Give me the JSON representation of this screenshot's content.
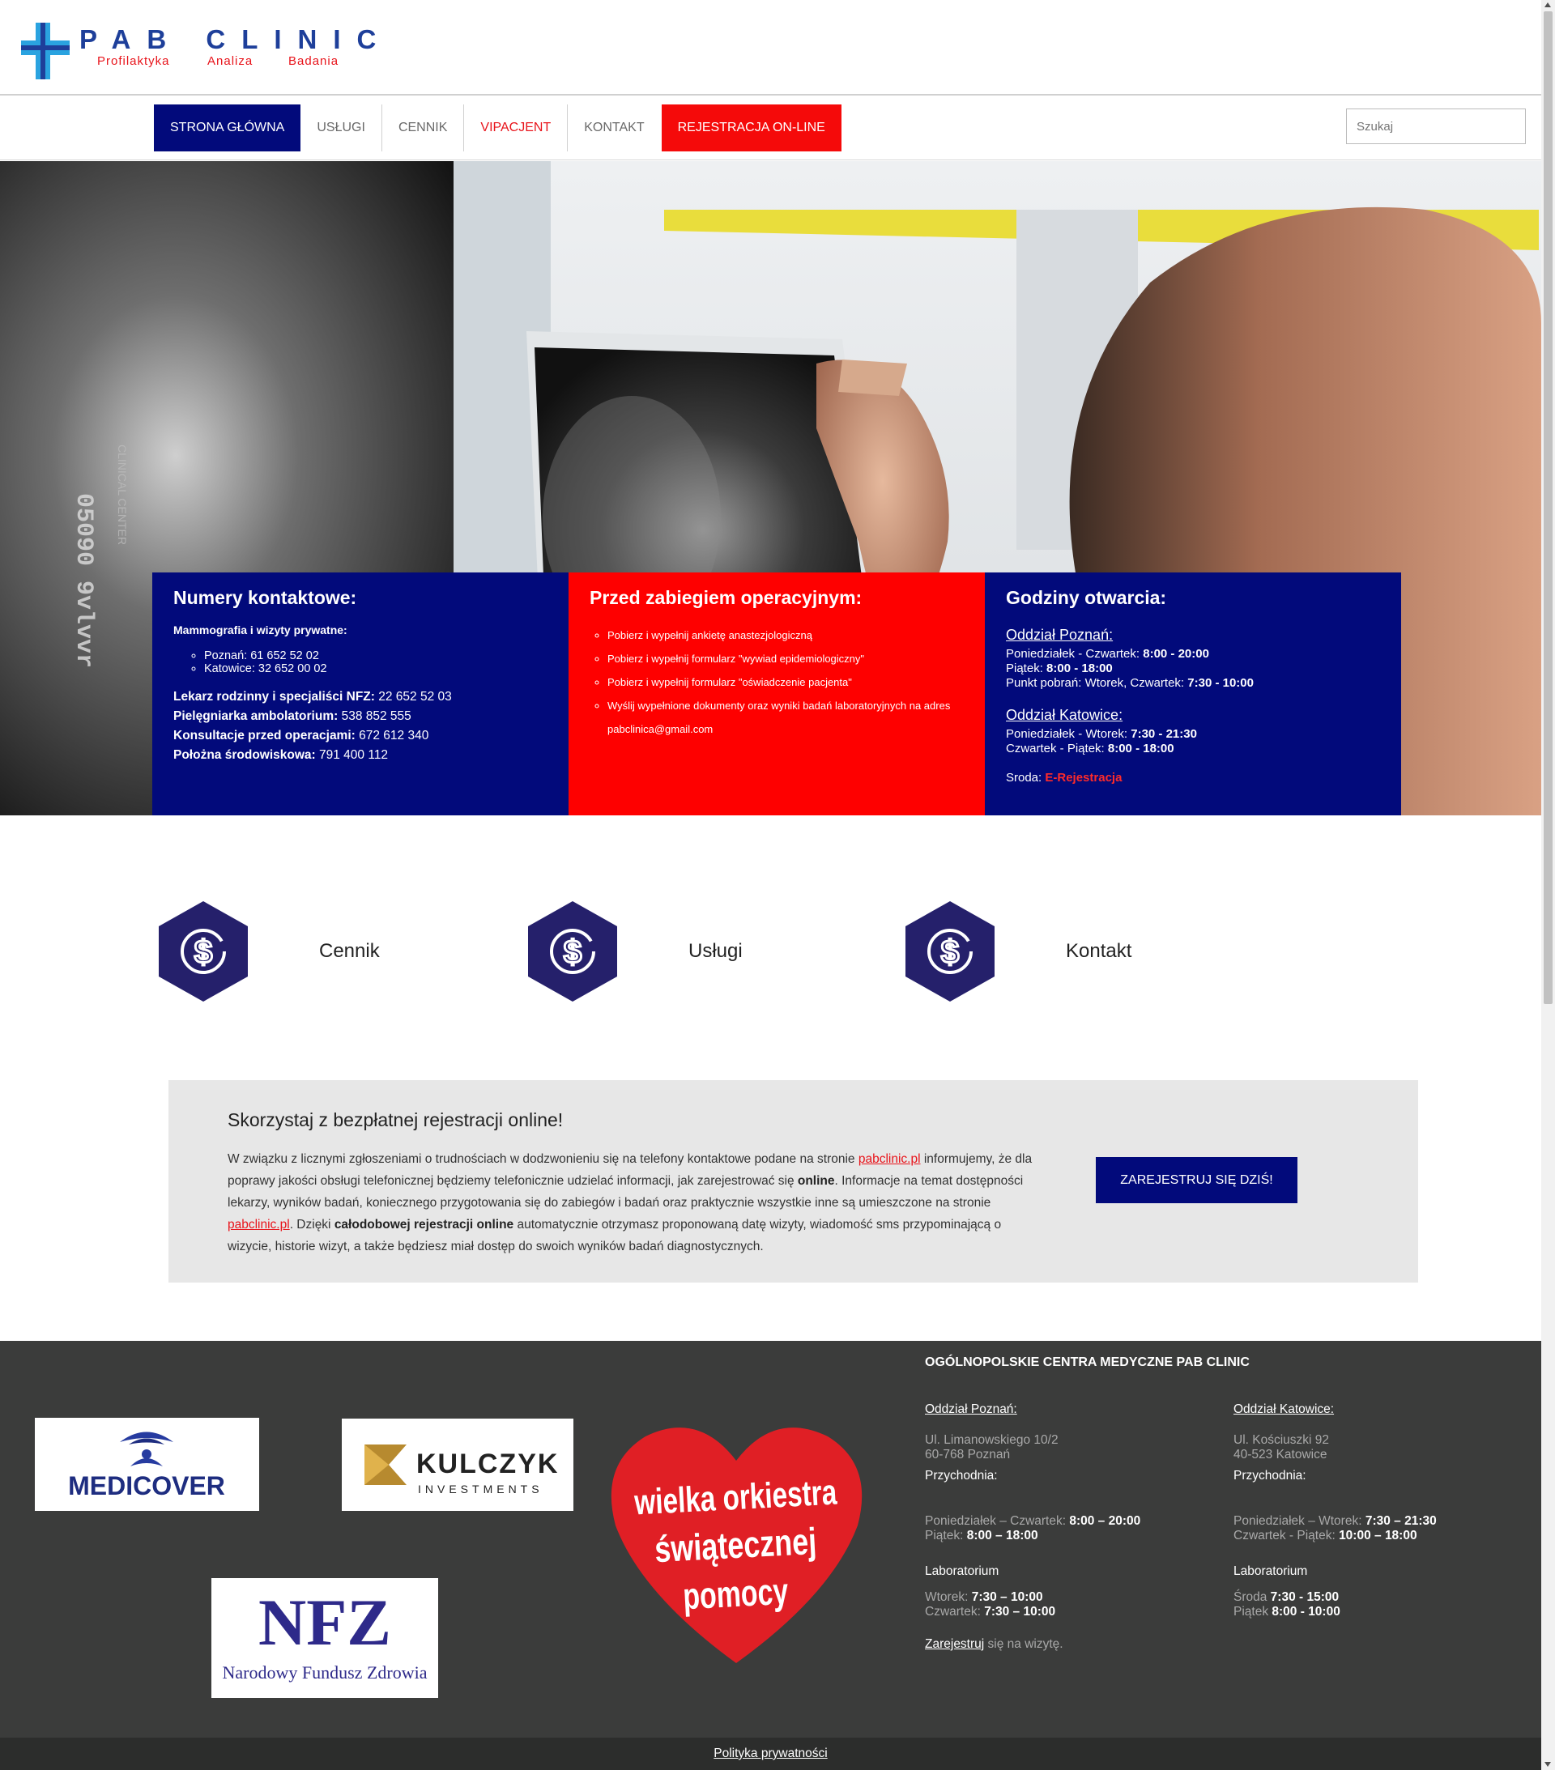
{
  "header": {
    "logo_title": "PAB CLINIC",
    "logo_subtitles": [
      "Profilaktyka",
      "Analiza",
      "Badania"
    ]
  },
  "nav": {
    "items": [
      {
        "label": "STRONA GŁÓWNA",
        "state": "active"
      },
      {
        "label": "USŁUGI"
      },
      {
        "label": "CENNIK"
      },
      {
        "label": "VIPACJENT"
      },
      {
        "label": "KONTAKT"
      },
      {
        "label": "REJESTRACJA ON-LINE"
      }
    ],
    "search_placeholder": "Szukaj"
  },
  "hero": {
    "image_text": "CLINICAL CENTER"
  },
  "contact_box": {
    "title": "Numery kontaktowe:",
    "subtitle": "Mammografia i wizyty prywatne:",
    "cities": [
      "Poznań: 61 652 52 02",
      "Katowice: 32 652 00 02"
    ],
    "lines": [
      {
        "label": "Lekarz rodzinny i specjaliści NFZ:",
        "value": " 22 652 52 03"
      },
      {
        "label": "Pielęgniarka ambolatorium:",
        "value": " 538 852 555"
      },
      {
        "label": "Konsultacje przed operacjami:",
        "value": " 672 612 340"
      },
      {
        "label": "Położna środowiskowa:",
        "value": " 791 400 112"
      }
    ]
  },
  "surgery_box": {
    "title": "Przed zabiegiem operacyjnym:",
    "items": [
      "Pobierz i wypełnij ankietę anastezjologiczną",
      "Pobierz i wypełnij formularz \"wywiad epidemiologiczny\"",
      "Pobierz i wypełnij formularz \"oświadczenie pacjenta\"",
      "Wyślij wypełnione dokumenty oraz wyniki badań laboratoryjnych na adres pabclinica@gmail.com"
    ]
  },
  "hours_box": {
    "title": "Godziny otwarcia:",
    "poznan": {
      "name": "Oddział Poznań:",
      "l1_label": "Poniedziałek - Czwartek: ",
      "l1_value": "8:00 - 20:00",
      "l2_label": "Piątek: ",
      "l2_value": "8:00 - 18:00",
      "l3_label": "Punkt pobrań: Wtorek, Czwartek: ",
      "l3_value": "7:30 - 10:00"
    },
    "katowice": {
      "name": "Oddział Katowice:",
      "l1_label": "Poniedziałek - Wtorek: ",
      "l1_value": "7:30 - 21:30",
      "l2_label": "Czwartek - Piątek: ",
      "l2_value": "8:00 - 18:00"
    },
    "wednesday_label": "Sroda: ",
    "wednesday_link": "E-Rejestracja"
  },
  "features": [
    {
      "label": "Cennik",
      "icon": "dollar-icon"
    },
    {
      "label": "Usługi",
      "icon": "dollar-icon"
    },
    {
      "label": "Kontakt",
      "icon": "dollar-icon"
    }
  ],
  "registration": {
    "title": "Skorzystaj z bezpłatnej rejestracji online!",
    "t1": "W związku z licznymi zgłoszeniami o trudnościach w dodzwonieniu się na telefony kontaktowe podane na stronie ",
    "link1": "pabclinic.pl",
    "t2": " informujemy, że dla poprawy jakości obsługi telefonicznej będziemy telefonicznie udzielać informacji, jak zarejestrować się ",
    "b1": "online",
    "t3": ". Informacje na temat dostępności lekarzy, wyników badań, koniecznego przygotowania się do zabiegów i badań oraz praktycznie wszystkie inne są umieszczone na stronie ",
    "link2": "pabclinic.pl",
    "t4": ". Dzięki ",
    "b2": "całodobowej rejestracji online",
    "t5": " automatycznie otrzymasz proponowaną datę wizyty, wiadomość sms przypominającą o wizycie, historie wizyt, a także będziesz miał dostęp do swoich wyników badań diagnostycznych.",
    "button": "ZAREJESTRUJ SIĘ DZIŚ!"
  },
  "partners": {
    "medicover": "MEDICOVER",
    "kulczyk": "KULCZYK",
    "kulczyk_sub": "INVESTMENTS",
    "nfz": "NFZ",
    "nfz_sub": "Narodowy Fundusz Zdrowia",
    "wosp": [
      "wielka orkiestra",
      "świątecznej",
      "pomocy"
    ]
  },
  "footer": {
    "title": "OGÓLNOPOLSKIE CENTRA MEDYCZNE PAB CLINIC",
    "poznan": {
      "name": "Oddział Poznań:",
      "address1": "Ul. Limanowskiego 10/2",
      "address2": "60-768 Poznań",
      "clinic_label": "Przychodnia:",
      "c1_label": "Poniedziałek – Czwartek: ",
      "c1_value": "8:00 – 20:00",
      "c2_label": "Piątek: ",
      "c2_value": "8:00 – 18:00",
      "lab_label": "Laboratorium",
      "lab1_label": "Wtorek: ",
      "lab1_value": "7:30 – 10:00",
      "lab2_label": "Czwartek: ",
      "lab2_value": "7:30 – 10:00",
      "register_link": "Zarejestruj",
      "register_text": " się na wizytę."
    },
    "katowice": {
      "name": "Oddział Katowice:",
      "address1": "Ul. Kościuszki 92",
      "address2": "40-523 Katowice",
      "clinic_label": "Przychodnia:",
      "c1_label": "Poniedziałek – Wtorek: ",
      "c1_value": "7:30 – 21:30",
      "c2_label": "Czwartek - Piątek: ",
      "c2_value": "10:00 – 18:00",
      "lab_label": "Laboratorium",
      "lab1_label": "Środa ",
      "lab1_value": "7:30 - 15:00",
      "lab2_label": "Piątek ",
      "lab2_value": "8:00 - 10:00"
    },
    "privacy": "Polityka prywatności"
  },
  "colors": {
    "navy": "#020a7b",
    "red": "#fe0000",
    "footer_bg": "#3b3c3b",
    "hex_fill": "#25206b"
  }
}
